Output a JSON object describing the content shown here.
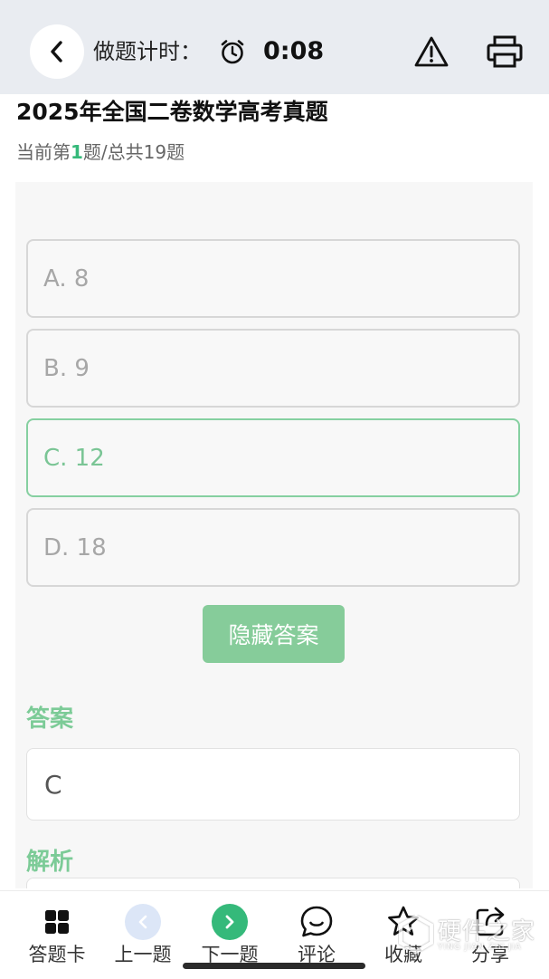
{
  "header": {
    "timer_label": "做题计时：",
    "timer_value": "0:08"
  },
  "exam": {
    "title": "2025年全国二卷数学高考真题",
    "progress_prefix": "当前第",
    "progress_current": "1",
    "progress_suffix": "题/总共19题"
  },
  "question": {
    "options": [
      {
        "label": "A. 8",
        "state": "normal"
      },
      {
        "label": "B. 9",
        "state": "normal"
      },
      {
        "label": "C. 12",
        "state": "correct"
      },
      {
        "label": "D. 18",
        "state": "normal"
      }
    ],
    "hide_answer_label": "隐藏答案",
    "answer_heading": "答案",
    "answer_value": "C",
    "analysis_heading": "解析"
  },
  "bottom_nav": {
    "items": [
      {
        "label": "答题卡",
        "icon": "grid-icon"
      },
      {
        "label": "上一题",
        "icon": "chevron-left-icon"
      },
      {
        "label": "下一题",
        "icon": "chevron-right-icon"
      },
      {
        "label": "评论",
        "icon": "comment-icon"
      },
      {
        "label": "收藏",
        "icon": "star-icon"
      },
      {
        "label": "分享",
        "icon": "share-icon"
      }
    ]
  },
  "watermark": {
    "text": "硬件之家",
    "sub": "YING JIAN ZHI JIA"
  },
  "colors": {
    "accent_green": "#35b97a",
    "correct_border": "#86d0a1",
    "button_green": "#86cc9a",
    "prev_circle": "#dce6f7",
    "topbar_bg": "#e9ecf1"
  }
}
